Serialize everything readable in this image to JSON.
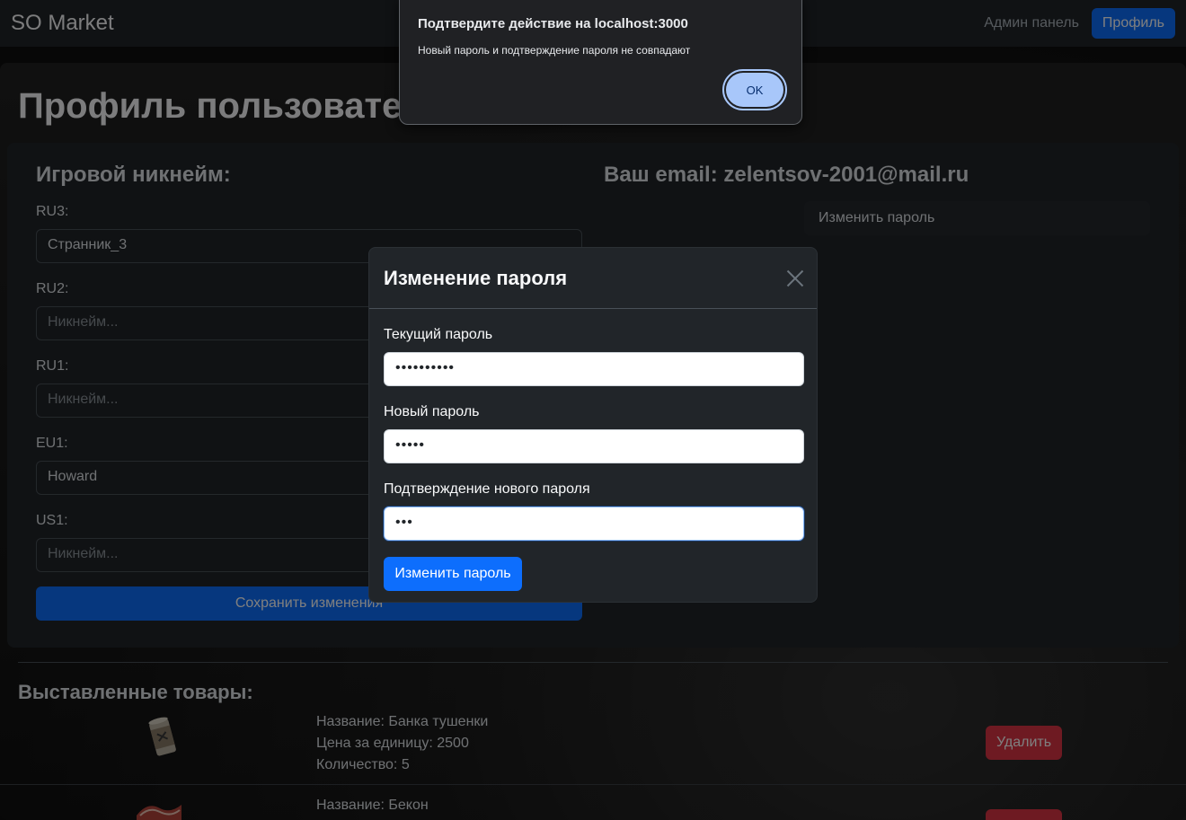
{
  "navbar": {
    "brand": "SO Market",
    "admin_link": "Админ панель",
    "profile_button": "Профиль"
  },
  "page": {
    "title": "Профиль пользовател"
  },
  "nicknames": {
    "heading": "Игровой никнейм:",
    "fields": [
      {
        "label": "RU3:",
        "value": "Странник_3",
        "placeholder": "Никнейм..."
      },
      {
        "label": "RU2:",
        "value": "",
        "placeholder": "Никнейм..."
      },
      {
        "label": "RU1:",
        "value": "",
        "placeholder": "Никнейм..."
      },
      {
        "label": "EU1:",
        "value": "Howard",
        "placeholder": "Никнейм..."
      },
      {
        "label": "US1:",
        "value": "",
        "placeholder": "Никнейм..."
      }
    ],
    "save_button": "Сохранить изменения"
  },
  "account": {
    "email_heading": "Ваш email: zelentsov-2001@mail.ru",
    "change_password_link": "Изменить пароль"
  },
  "products": {
    "heading": "Выставленные товары:",
    "items": [
      {
        "name": "Название: Банка тушенки",
        "price": "Цена за единицу: 2500",
        "qty": "Количество: 5",
        "delete": "Удалить",
        "icon": "tin-can-icon"
      },
      {
        "name": "Название: Бекон",
        "delete": "Удалить",
        "icon": "bacon-icon"
      }
    ]
  },
  "modal": {
    "title": "Изменение пароля",
    "current_label": "Текущий пароль",
    "current_value": "••••••••••",
    "new_label": "Новый пароль",
    "new_value": "•••••",
    "confirm_label": "Подтверждение нового пароля",
    "confirm_value": "•••",
    "submit": "Изменить пароль"
  },
  "dialog": {
    "title": "Подтвердите действие на localhost:3000",
    "message": "Новый пароль и подтверждение пароля не совпадают",
    "ok": "OK"
  },
  "colors": {
    "primary": "#0d6efd",
    "danger": "#dc3545",
    "surface": "#212529"
  }
}
